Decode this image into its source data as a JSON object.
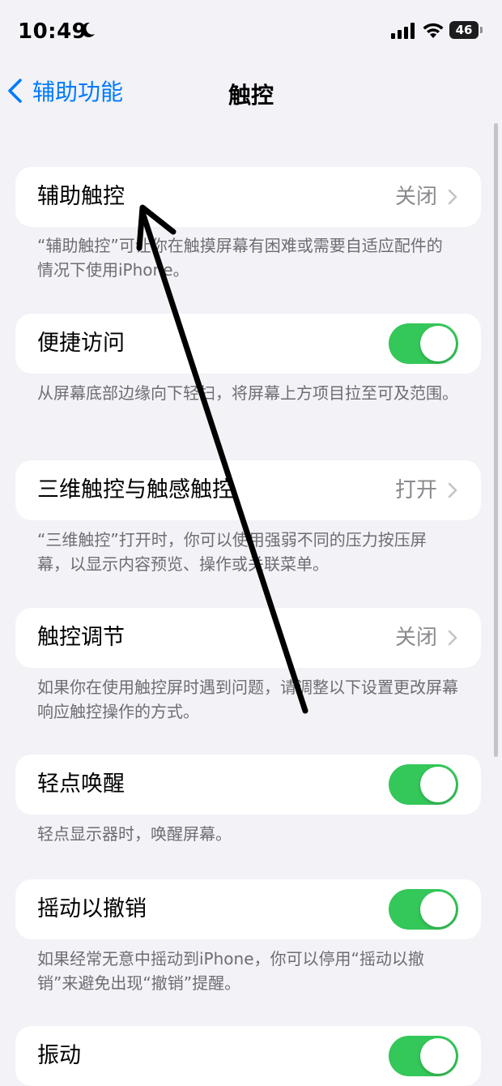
{
  "status_bar": {
    "time": "10:49",
    "battery_level": "46",
    "icons": [
      "moon-icon",
      "signal-icon",
      "wifi-icon",
      "battery-icon"
    ]
  },
  "nav": {
    "back_label": "辅助功能",
    "title": "触控"
  },
  "rows": [
    {
      "label": "辅助触控",
      "value": "关闭",
      "footer": "“辅助触控”可让你在触摸屏幕有困难或需要自适应配件的情况下使用iPhone。"
    },
    {
      "label": "便捷访问",
      "toggle": true,
      "footer": "从屏幕底部边缘向下轻扫，将屏幕上方项目拉至可及范围。"
    },
    {
      "label": "三维触控与触感触控",
      "value": "打开",
      "footer": "“三维触控”打开时，你可以使用强弱不同的压力按压屏幕，以显示内容预览、操作或关联菜单。"
    },
    {
      "label": "触控调节",
      "value": "关闭",
      "footer": "如果你在使用触控屏时遇到问题，请调整以下设置更改屏幕响应触控操作的方式。"
    },
    {
      "label": "轻点唤醒",
      "toggle": true,
      "footer": "轻点显示器时，唤醒屏幕。"
    },
    {
      "label": "摇动以撤销",
      "toggle": true,
      "footer": "如果经常无意中摇动到iPhone，你可以停用“摇动以撤销”来避免出现“撤销”提醒。"
    },
    {
      "label": "振动",
      "toggle": true
    }
  ],
  "colors": {
    "accent": "#007aff",
    "toggle_on": "#34c759",
    "background": "#f2f2f7",
    "annotation_arrow": "#000000"
  }
}
